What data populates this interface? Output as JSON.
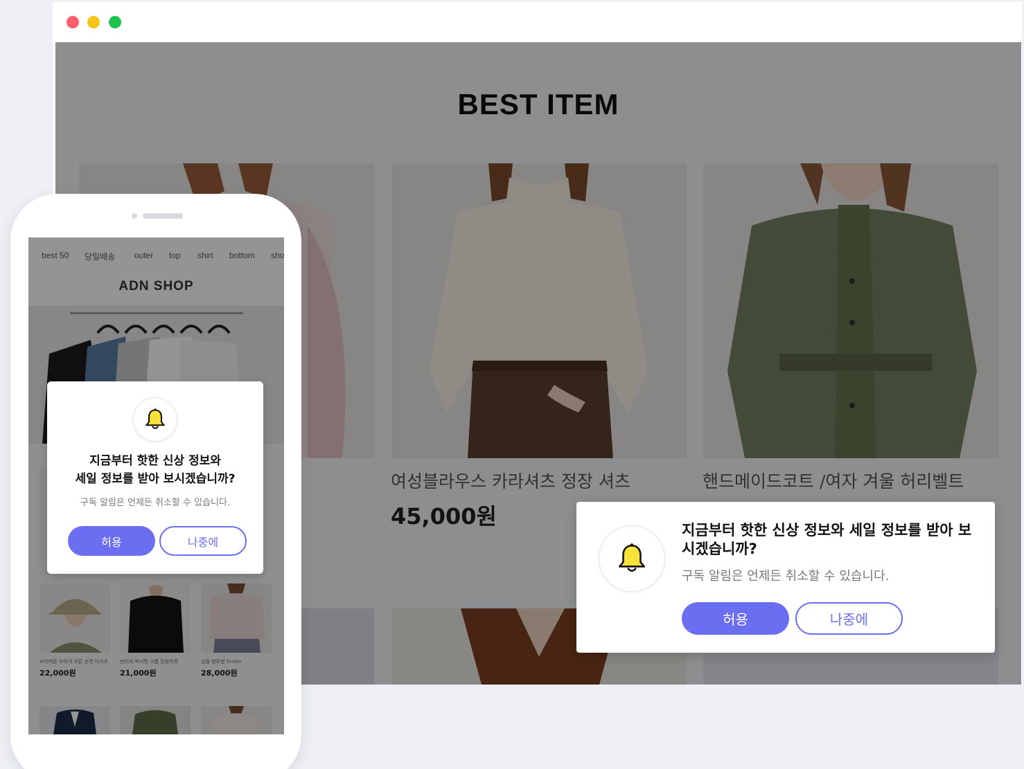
{
  "browser": {
    "window_controls": [
      "close",
      "minimize",
      "maximize"
    ],
    "page_title": "BEST ITEM",
    "products": [
      {
        "name": "",
        "price": ""
      },
      {
        "name": "여성블라우스 카라셔츠 정장 셔츠",
        "price": "45,000원"
      },
      {
        "name": "핸드메이드코트 /여자 겨울 허리벨트",
        "price": ""
      }
    ],
    "popup": {
      "message": "지금부터 핫한 신상 정보와 세일 정보를 받아 보시겠습니까?",
      "sub": "구독 알림은 언제든 취소할 수 있습니다.",
      "allow_label": "허용",
      "later_label": "나중에",
      "icon": "bell-icon"
    }
  },
  "mobile": {
    "nav": [
      "best 50",
      "당일배송",
      "outer",
      "top",
      "shirt",
      "bottom",
      "sho"
    ],
    "logo": "ADN SHOP",
    "products": [
      {
        "name": "쓰리버튼 브이넥 코튼 순면 티셔츠",
        "price": "22,000원"
      },
      {
        "name": "빈티지 박시핏 크롭 진청자켓",
        "price": "21,000원"
      },
      {
        "name": "심플 맨투맨 5color",
        "price": "28,000원"
      }
    ],
    "popup": {
      "message_line1": "지금부터 핫한 신상 정보와",
      "message_line2": "세일 정보를 받아 보시겠습니까?",
      "sub": "구독 알림은 언제든 취소할 수 있습니다.",
      "allow_label": "허용",
      "later_label": "나중에",
      "icon": "bell-icon"
    }
  },
  "colors": {
    "accent": "#6b6ef1",
    "bell": "#f7e13a",
    "close_dot": "#ff5f6d",
    "minimize_dot": "#f5c518",
    "maximize_dot": "#1fc24c"
  }
}
